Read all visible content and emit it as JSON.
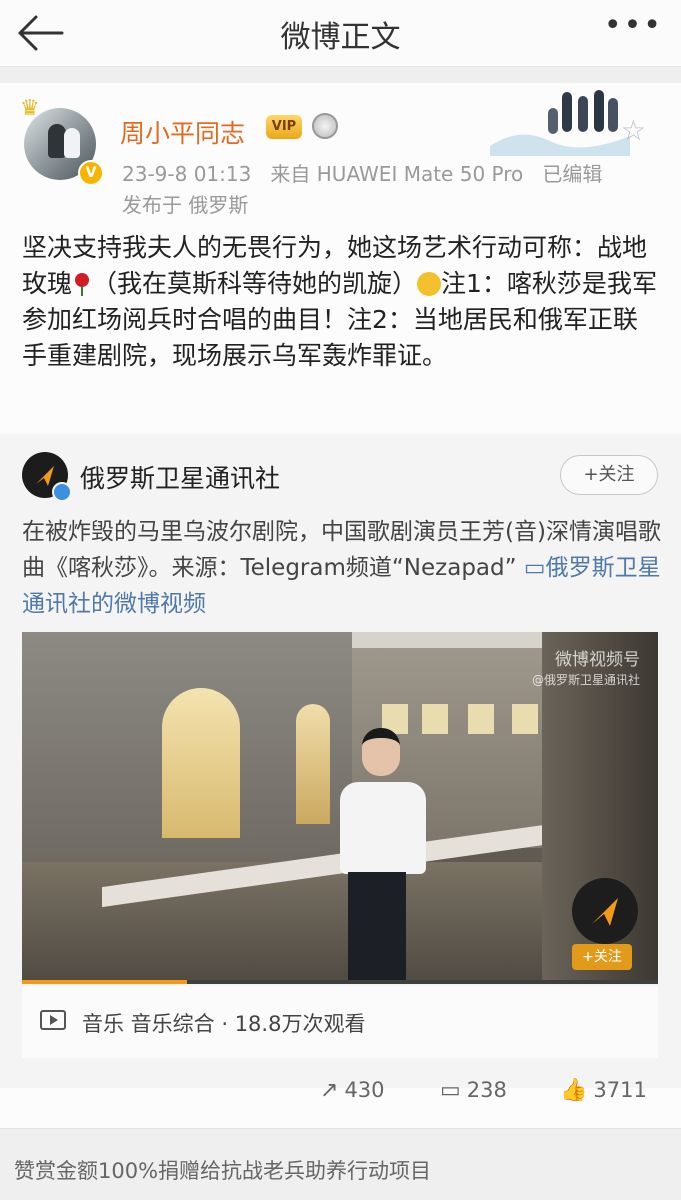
{
  "header": {
    "title": "微博正文",
    "back_icon": "back-arrow-icon",
    "more_label": "•••"
  },
  "post": {
    "username": "周小平同志",
    "vip_label": "VIP",
    "avatar_badge": "V",
    "meta_time": "23-9-8 01:13",
    "meta_source_prefix": "来自",
    "meta_device": "HUAWEI Mate 50 Pro",
    "meta_edited": "已编辑",
    "location": "发布于 俄罗斯",
    "text_part1": "坚决支持我夫人的无畏行为，她这场艺术行动可称：战地玫瑰",
    "text_part2": "（我在莫斯科等待她的凯旋）",
    "text_part3": "注1：喀秋莎是我军参加红场阅兵时合唱的曲目！注2：当地居民和俄军正联手重建剧院，现场展示乌军轰炸罪证。"
  },
  "repost": {
    "author": "俄罗斯卫星通讯社",
    "follow_label": "+关注",
    "text_main": "在被炸毁的马里乌波尔剧院，中国歌剧演员王芳(音)深情演唱歌曲《喀秋莎》。来源：Telegram频道“Nezapad”",
    "link_text": "俄罗斯卫星通讯社的微博视频",
    "video_watermark_line1": "微博视频号",
    "video_watermark_line2": "@俄罗斯卫星通讯社",
    "video_follow_label": "+关注",
    "video_progress": 0.26,
    "video_info": "音乐 音乐综合 · 18.8万次观看"
  },
  "actions": {
    "repost_count": "430",
    "comment_count": "238",
    "like_count": "3711"
  },
  "footer": {
    "text": "赞赏金额100%捐赠给抗战老兵助养行动项目"
  },
  "colors": {
    "username": "#e06b21",
    "link": "#4f79a8",
    "progress": "#f39b18"
  }
}
